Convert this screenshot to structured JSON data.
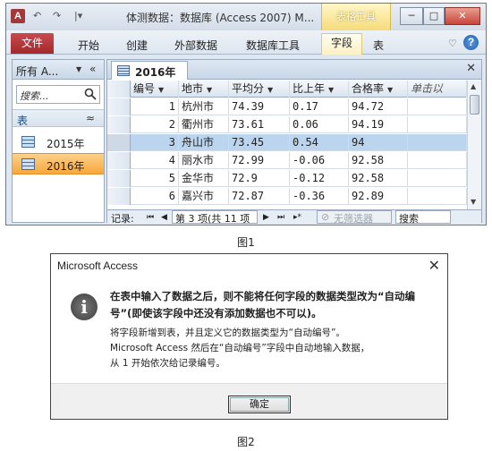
{
  "window": {
    "title": "体测数据：数据库 (Access 2007) M...",
    "contextual_tab_group": "表格工具",
    "app_icon_letter": "A",
    "quick_access": [
      "↶",
      "↷",
      "|▾"
    ],
    "controls": [
      "─",
      "□",
      "✕"
    ]
  },
  "ribbon": {
    "file_tab": "文件",
    "tabs": [
      "开始",
      "创建",
      "外部数据",
      "数据库工具"
    ],
    "tool_tabs": [
      "字段",
      "表"
    ],
    "accent": "#a3282b"
  },
  "nav_pane": {
    "title": "所有 A...",
    "search_placeholder": "搜索...",
    "group": "表",
    "items": [
      {
        "label": "2015年",
        "selected": false
      },
      {
        "label": "2016年",
        "selected": true
      }
    ]
  },
  "document": {
    "tab_label": "2016年",
    "columns": [
      "编号",
      "地市",
      "平均分",
      "比上年",
      "合格率",
      "单击以"
    ],
    "rows": [
      {
        "id": "1",
        "city": "杭州市",
        "avg": "74.39",
        "ratio": "0.17",
        "pass": "94.72"
      },
      {
        "id": "2",
        "city": "衢州市",
        "avg": "73.61",
        "ratio": "0.06",
        "pass": "94.19"
      },
      {
        "id": "3",
        "city": "舟山市",
        "avg": "73.45",
        "ratio": "0.54",
        "pass": "94"
      },
      {
        "id": "4",
        "city": "丽水市",
        "avg": "72.99",
        "ratio": "-0.06",
        "pass": "92.58"
      },
      {
        "id": "5",
        "city": "金华市",
        "avg": "72.9",
        "ratio": "-0.12",
        "pass": "92.58"
      },
      {
        "id": "6",
        "city": "嘉兴市",
        "avg": "72.87",
        "ratio": "-0.36",
        "pass": "92.89"
      }
    ],
    "selected_row": 2,
    "record_nav": {
      "label": "记录:",
      "first": "⏮",
      "prev": "◀",
      "position": "第 3 项(共 11 项",
      "next": "▶",
      "last": "⏭",
      "new": "▸*",
      "filter": "无筛选器",
      "search": "搜索"
    }
  },
  "captions": {
    "fig1": "图1",
    "fig2": "图2"
  },
  "dialog": {
    "title": "Microsoft Access",
    "close": "✕",
    "icon_glyph": "i",
    "main_message": "在表中输入了数据之后，则不能将任何字段的数据类型改为“自动编号”(即使该字段中还没有添加数据也不可以)。",
    "detail_lines": [
      "将字段新增到表，并且定义它的数据类型为“自动编号”。",
      "Microsoft Access 然后在“自动编号”字段中自动地输入数据，",
      "从 1 开始依次给记录编号。"
    ],
    "ok_label": "确定"
  }
}
